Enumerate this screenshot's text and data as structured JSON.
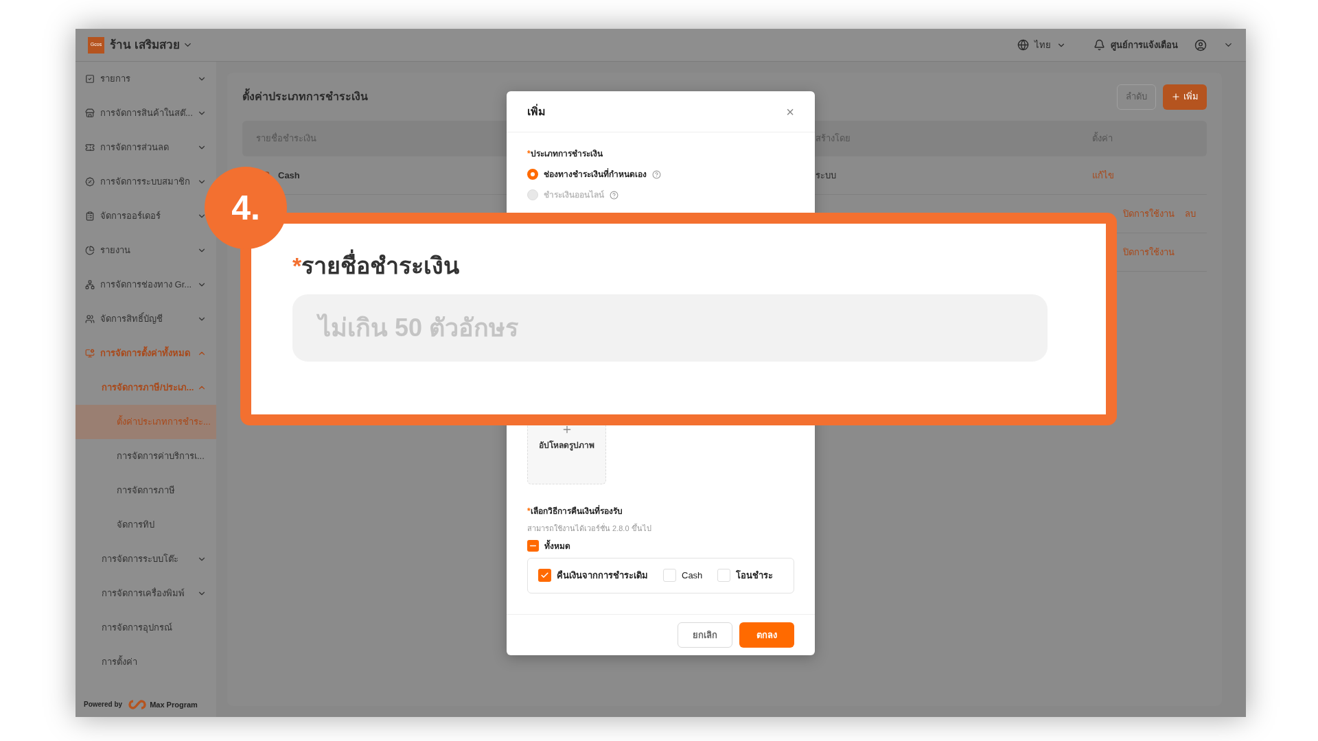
{
  "header": {
    "store_logo": "Gcos",
    "store_name": "ร้าน เสริมสวย",
    "language": "ไทย",
    "notifications": "ศูนย์การแจ้งเตือน"
  },
  "sidebar": {
    "items": [
      {
        "label": "รายการ",
        "expanded": false,
        "selected": false
      },
      {
        "label": "การจัดการสินค้าในสต๊...",
        "expanded": false,
        "selected": false
      },
      {
        "label": "การจัดการส่วนลด",
        "expanded": false,
        "selected": false
      },
      {
        "label": "การจัดการระบบสมาชิก",
        "expanded": false,
        "selected": false
      },
      {
        "label": "จัดการออร์เดอร์",
        "expanded": false,
        "selected": false
      },
      {
        "label": "รายงาน",
        "expanded": false,
        "selected": false
      },
      {
        "label": "การจัดการช่องทาง Gr...",
        "expanded": false,
        "selected": false
      },
      {
        "label": "จัดการสิทธิ์บัญชี",
        "expanded": false,
        "selected": false
      },
      {
        "label": "การจัดการตั้งค่าทั้งหมด",
        "expanded": true,
        "selected": false,
        "children": [
          {
            "label": "การจัดการภาษี/ประเภ...",
            "expanded": true,
            "selected": false,
            "children": [
              {
                "label": "ตั้งค่าประเภทการชำระ...",
                "selected": true
              },
              {
                "label": "การจัดการค่าบริการเ...",
                "selected": false
              },
              {
                "label": "การจัดการภาษี",
                "selected": false
              },
              {
                "label": "จัดการทิป",
                "selected": false
              }
            ]
          },
          {
            "label": "การจัดการระบบโต๊ะ",
            "expanded": false,
            "selected": false
          },
          {
            "label": "การจัดการเครื่องพิมพ์",
            "expanded": false,
            "selected": false
          },
          {
            "label": "การจัดการอุปกรณ์",
            "selected": false
          },
          {
            "label": "การตั้งค่า",
            "selected": false
          }
        ]
      }
    ],
    "powered_by": "Powered by",
    "brand": "Max Program"
  },
  "page": {
    "title": "ตั้งค่าประเภทการชำระเงิน",
    "buttons": [
      {
        "label": "ลำดับ",
        "kind": "outline"
      },
      {
        "label": "เพิ่ม",
        "kind": "primary"
      }
    ],
    "table": {
      "columns": [
        "รายชื่อชำระเงิน",
        "สร้างโดย",
        "ตั้งค่า"
      ],
      "rows": [
        {
          "name": "Cash",
          "created_by": "ระบบ",
          "edit": "แก้ไข"
        },
        {
          "disable": "ปิดการใช้งาน",
          "delete": "ลบ"
        },
        {
          "disable": "ปิดการใช้งาน"
        }
      ]
    }
  },
  "modal": {
    "title": "เพิ่ม",
    "close": "×",
    "type_field": {
      "mark": "*",
      "label": "ประเภทการชำระเงิน",
      "options": [
        {
          "label": "ช่องทางชำระเงินที่กำหนดเอง",
          "selected": true,
          "disabled": false
        },
        {
          "label": "ชำระเงินออนไลน์",
          "selected": false,
          "disabled": true
        }
      ]
    },
    "upload": {
      "label": "อัปโหลดรูปภาพ"
    },
    "refund_field": {
      "mark": "*",
      "label": "เลือกวิธีการคืนเงินที่รองรับ",
      "hint": "สามารถใช้งานได้เวอร์ชั่น 2.8.0 ขึ้นไป",
      "all": {
        "label": "ทั้งหมด",
        "indeterminate": true
      },
      "options": [
        {
          "label": "คืนเงินจากการชำระเดิม",
          "checked": true
        },
        {
          "label": "Cash",
          "checked": false
        },
        {
          "label": "โอนชำระ",
          "checked": false
        }
      ]
    },
    "buttons": [
      {
        "label": "ยกเลิก",
        "kind": "outline"
      },
      {
        "label": "ตกลง",
        "kind": "primary"
      }
    ]
  },
  "callout": {
    "step": "4.",
    "mark": "*",
    "label": "รายชื่อชำระเงิน",
    "placeholder": "ไม่เกิน 50 ตัวอักษร"
  }
}
